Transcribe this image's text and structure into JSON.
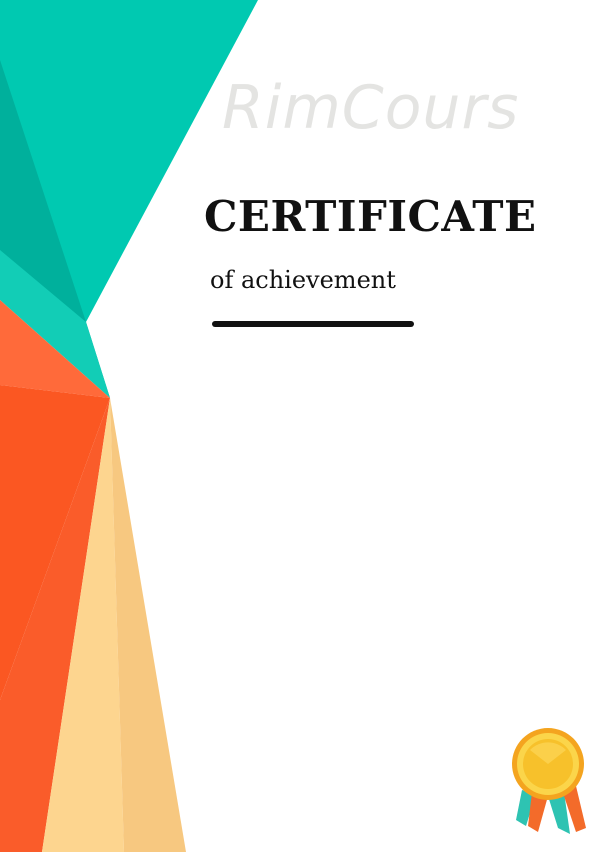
{
  "certificate": {
    "watermark": "RimCours",
    "title": "CERTIFICATE",
    "subtitle": "of achievement"
  },
  "colors": {
    "teal": "#00c9b1",
    "teal_dark": "#00b09c",
    "orange_light": "#ff6a3a",
    "orange": "#fb5722",
    "orange_dark": "#f2552a",
    "peach": "#fdd58f",
    "peach_dark": "#f6c67e",
    "medal_gold": "#f7c12b",
    "medal_rim": "#f4a41f",
    "ribbon_teal": "#2ec3b2",
    "ribbon_orange": "#f36b2a"
  },
  "icons": {
    "medal": "award-medal-icon"
  }
}
